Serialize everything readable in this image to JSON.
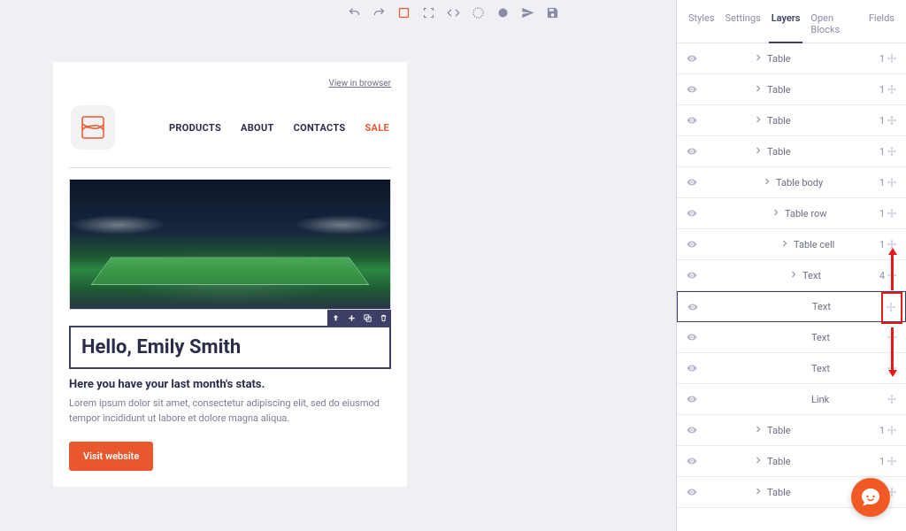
{
  "toolbar_icons": [
    "undo",
    "redo",
    "outline",
    "fullscreen",
    "code",
    "preview",
    "circle",
    "send",
    "save"
  ],
  "panel_tabs": [
    "Styles",
    "Settings",
    "Layers",
    "Open Blocks",
    "Fields"
  ],
  "active_tab": "Layers",
  "email": {
    "view_in_browser": "View in browser",
    "nav": {
      "products": "PRODUCTS",
      "about": "ABOUT",
      "contacts": "CONTACTS",
      "sale": "SALE"
    },
    "heading": "Hello, Emily Smith",
    "sub": "Here you have your last month's stats.",
    "lorem": "Lorem ipsum dolor sit amet, consectetur adipiscing elit, sed do eiusmod tempor incididunt ut labore et dolore magna aliqua.",
    "cta": "Visit website"
  },
  "layers": [
    {
      "indent": 60,
      "chev": true,
      "name": "Table",
      "count": "1"
    },
    {
      "indent": 60,
      "chev": true,
      "name": "Table",
      "count": "1"
    },
    {
      "indent": 60,
      "chev": true,
      "name": "Table",
      "count": "1"
    },
    {
      "indent": 60,
      "chev": true,
      "name": "Table",
      "count": "1"
    },
    {
      "indent": 70,
      "chev": true,
      "name": "Table body",
      "count": "1"
    },
    {
      "indent": 80,
      "chev": true,
      "name": "Table row",
      "count": "1"
    },
    {
      "indent": 90,
      "chev": true,
      "name": "Table cell",
      "count": "1"
    },
    {
      "indent": 100,
      "chev": true,
      "name": "Text",
      "count": "4"
    },
    {
      "indent": 110,
      "chev": false,
      "name": "Text",
      "count": "",
      "selected": true
    },
    {
      "indent": 110,
      "chev": false,
      "name": "Text",
      "count": ""
    },
    {
      "indent": 110,
      "chev": false,
      "name": "Text",
      "count": ""
    },
    {
      "indent": 110,
      "chev": false,
      "name": "Link",
      "count": ""
    },
    {
      "indent": 60,
      "chev": true,
      "name": "Table",
      "count": "1"
    },
    {
      "indent": 60,
      "chev": true,
      "name": "Table",
      "count": "1"
    },
    {
      "indent": 60,
      "chev": true,
      "name": "Table",
      "count": ""
    }
  ]
}
